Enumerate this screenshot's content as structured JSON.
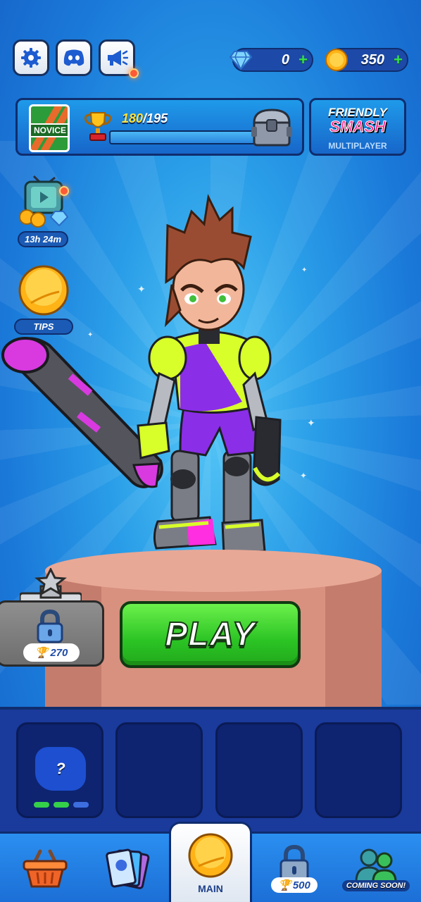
{
  "top_bar": {
    "gems": "0",
    "coins": "350",
    "plus_symbol": "+"
  },
  "trophy_road": {
    "rank": "NOVICE",
    "progress_current": "180",
    "progress_separator": "/",
    "progress_max": "195",
    "progress_fraction": 0.923
  },
  "friendly_smash": {
    "line1": "FRIENDLY",
    "line2": "SMASH",
    "subtitle": "MULTIPLAYER"
  },
  "left_widgets": {
    "tv_timer": "13h 24m",
    "tips_label": "TIPS"
  },
  "locked_character": {
    "trophy_requirement": "270"
  },
  "play_button": {
    "label": "PLAY"
  },
  "slots": {
    "mystery_label": "?",
    "progress_dots": [
      "#35d04a",
      "#35d04a",
      "#3c6ee0"
    ]
  },
  "bottom_nav": {
    "main_label": "MAIN",
    "locked_trophy_requirement": "500",
    "coming_soon_label": "COMING SOON!"
  },
  "colors": {
    "accent_green": "#2bc424",
    "dark_outline": "#0f2d6e",
    "trophy_yellow": "#ffe23a"
  }
}
